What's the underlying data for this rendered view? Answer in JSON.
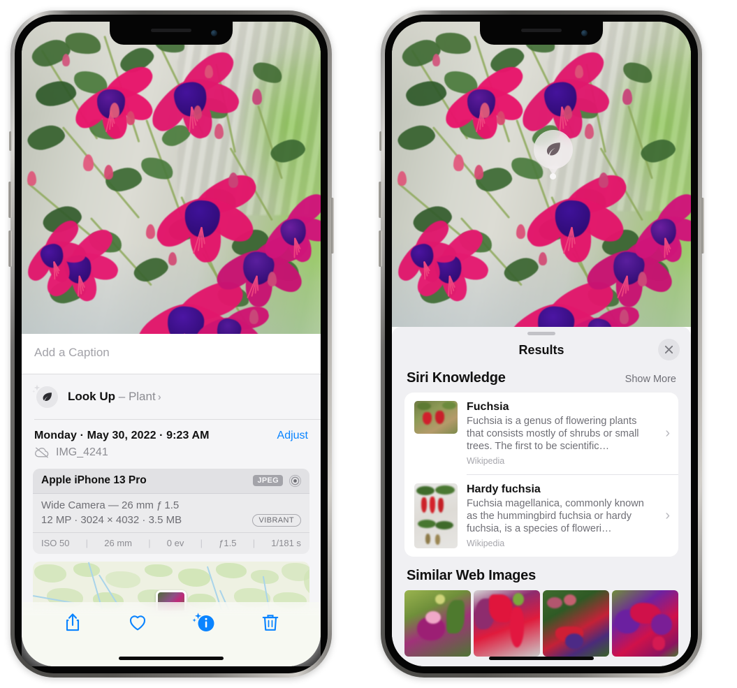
{
  "left_phone": {
    "caption": {
      "placeholder": "Add a Caption",
      "value": ""
    },
    "lookup_row": {
      "icon": "leaf-sparkle-icon",
      "label": "Look Up",
      "dash": "–",
      "subject": "Plant",
      "chevron": "›"
    },
    "date_row": {
      "date": "Monday · May 30, 2022 · 9:23 AM",
      "adjust_label": "Adjust"
    },
    "file_row": {
      "icon": "cloud-slash-icon",
      "filename": "IMG_4241"
    },
    "camera_card": {
      "model": "Apple iPhone 13 Pro",
      "format_badge": "JPEG",
      "aperture_icon": "aperture-icon",
      "lens_line": "Wide Camera — 26 mm ƒ 1.5",
      "size_line": "12 MP · 3024 × 4032 · 3.5 MB",
      "style_badge": "VIBRANT",
      "exif": [
        "ISO 50",
        "26 mm",
        "0 ev",
        "ƒ1.5",
        "1/181 s"
      ],
      "exif_divider": "|"
    },
    "toolbar": [
      {
        "name": "share-icon",
        "label": "Share"
      },
      {
        "name": "heart-icon",
        "label": "Favorite"
      },
      {
        "name": "info-sparkle-icon",
        "label": "Info"
      },
      {
        "name": "trash-icon",
        "label": "Delete"
      }
    ]
  },
  "right_phone": {
    "badge": {
      "icon": "leaf-icon",
      "name": "visual-look-up-badge"
    },
    "sheet": {
      "title": "Results",
      "close_icon": "close-icon"
    },
    "siri_knowledge": {
      "title": "Siri Knowledge",
      "show_more": "Show More",
      "items": [
        {
          "title": "Fuchsia",
          "description": "Fuchsia is a genus of flowering plants that consists mostly of shrubs or small trees. The first to be scientific…",
          "source": "Wikipedia",
          "chevron": "›"
        },
        {
          "title": "Hardy fuchsia",
          "description": "Fuchsia magellanica, commonly known as the hummingbird fuchsia or hardy fuchsia, is a species of floweri…",
          "source": "Wikipedia",
          "chevron": "›"
        }
      ]
    },
    "similar_web_images": {
      "title": "Similar Web Images",
      "thumbnails": [
        "fuchsia-web-image-1",
        "fuchsia-web-image-2",
        "fuchsia-web-image-3",
        "fuchsia-web-image-4"
      ]
    }
  },
  "colors": {
    "accent_blue": "#0a84ff",
    "sheet_bg": "#f0f0f3",
    "card_bg": "#ffffff",
    "secondary_text": "#6f6f76",
    "placeholder_text": "#a2a2a8"
  }
}
